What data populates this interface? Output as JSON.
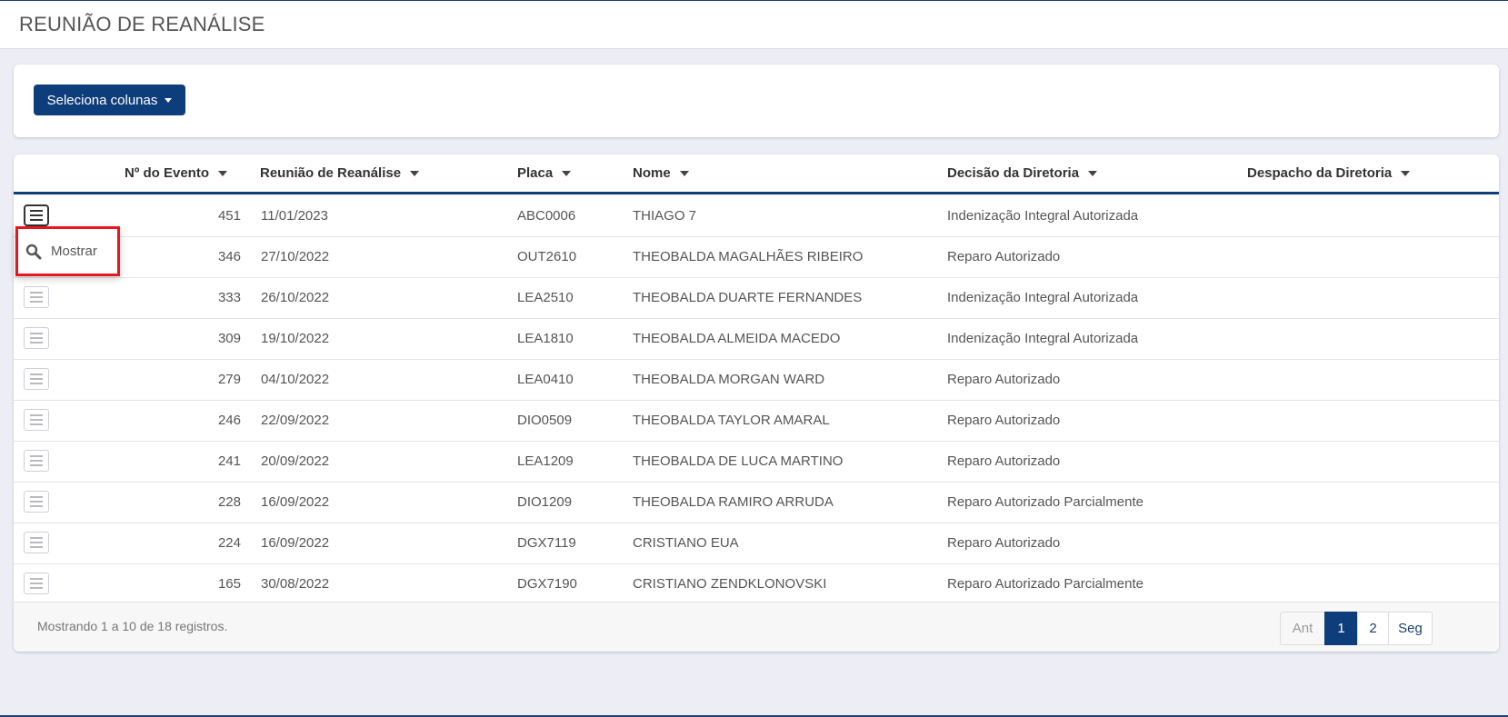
{
  "page": {
    "title": "REUNIÃO DE REANÁLISE"
  },
  "toolbar": {
    "select_columns_label": "Seleciona colunas"
  },
  "table": {
    "columns": [
      "Nº do Evento",
      "Reunião de Reanálise",
      "Placa",
      "Nome",
      "Decisão da Diretoria",
      "Despacho da Diretoria"
    ],
    "rows": [
      {
        "evento": "451",
        "reuniao": "11/01/2023",
        "placa": "ABC0006",
        "nome": "THIAGO 7",
        "decisao": "Indenização Integral Autorizada",
        "despacho": ""
      },
      {
        "evento": "346",
        "reuniao": "27/10/2022",
        "placa": "OUT2610",
        "nome": "THEOBALDA MAGALHÃES RIBEIRO",
        "decisao": "Reparo Autorizado",
        "despacho": ""
      },
      {
        "evento": "333",
        "reuniao": "26/10/2022",
        "placa": "LEA2510",
        "nome": "THEOBALDA DUARTE FERNANDES",
        "decisao": "Indenização Integral Autorizada",
        "despacho": ""
      },
      {
        "evento": "309",
        "reuniao": "19/10/2022",
        "placa": "LEA1810",
        "nome": "THEOBALDA ALMEIDA MACEDO",
        "decisao": "Indenização Integral Autorizada",
        "despacho": ""
      },
      {
        "evento": "279",
        "reuniao": "04/10/2022",
        "placa": "LEA0410",
        "nome": "THEOBALDA MORGAN WARD",
        "decisao": "Reparo Autorizado",
        "despacho": ""
      },
      {
        "evento": "246",
        "reuniao": "22/09/2022",
        "placa": "DIO0509",
        "nome": "THEOBALDA TAYLOR AMARAL",
        "decisao": "Reparo Autorizado",
        "despacho": ""
      },
      {
        "evento": "241",
        "reuniao": "20/09/2022",
        "placa": "LEA1209",
        "nome": "THEOBALDA DE LUCA MARTINO",
        "decisao": "Reparo Autorizado",
        "despacho": ""
      },
      {
        "evento": "228",
        "reuniao": "16/09/2022",
        "placa": "DIO1209",
        "nome": "THEOBALDA RAMIRO ARRUDA",
        "decisao": "Reparo Autorizado Parcialmente",
        "despacho": ""
      },
      {
        "evento": "224",
        "reuniao": "16/09/2022",
        "placa": "DGX7119",
        "nome": "CRISTIANO EUA",
        "decisao": "Reparo Autorizado",
        "despacho": ""
      },
      {
        "evento": "165",
        "reuniao": "30/08/2022",
        "placa": "DGX7190",
        "nome": "CRISTIANO ZENDKLONOVSKI",
        "decisao": "Reparo Autorizado Parcialmente",
        "despacho": ""
      }
    ]
  },
  "row_menu": {
    "show_label": "Mostrar",
    "icon": "search-icon"
  },
  "footer": {
    "info": "Mostrando 1 a 10 de 18 registros."
  },
  "pagination": {
    "prev": "Ant",
    "pages": [
      "1",
      "2"
    ],
    "current": "1",
    "next": "Seg"
  },
  "colors": {
    "primary": "#0d3d7a",
    "highlight": "#e8161e",
    "background": "#ededf5"
  }
}
